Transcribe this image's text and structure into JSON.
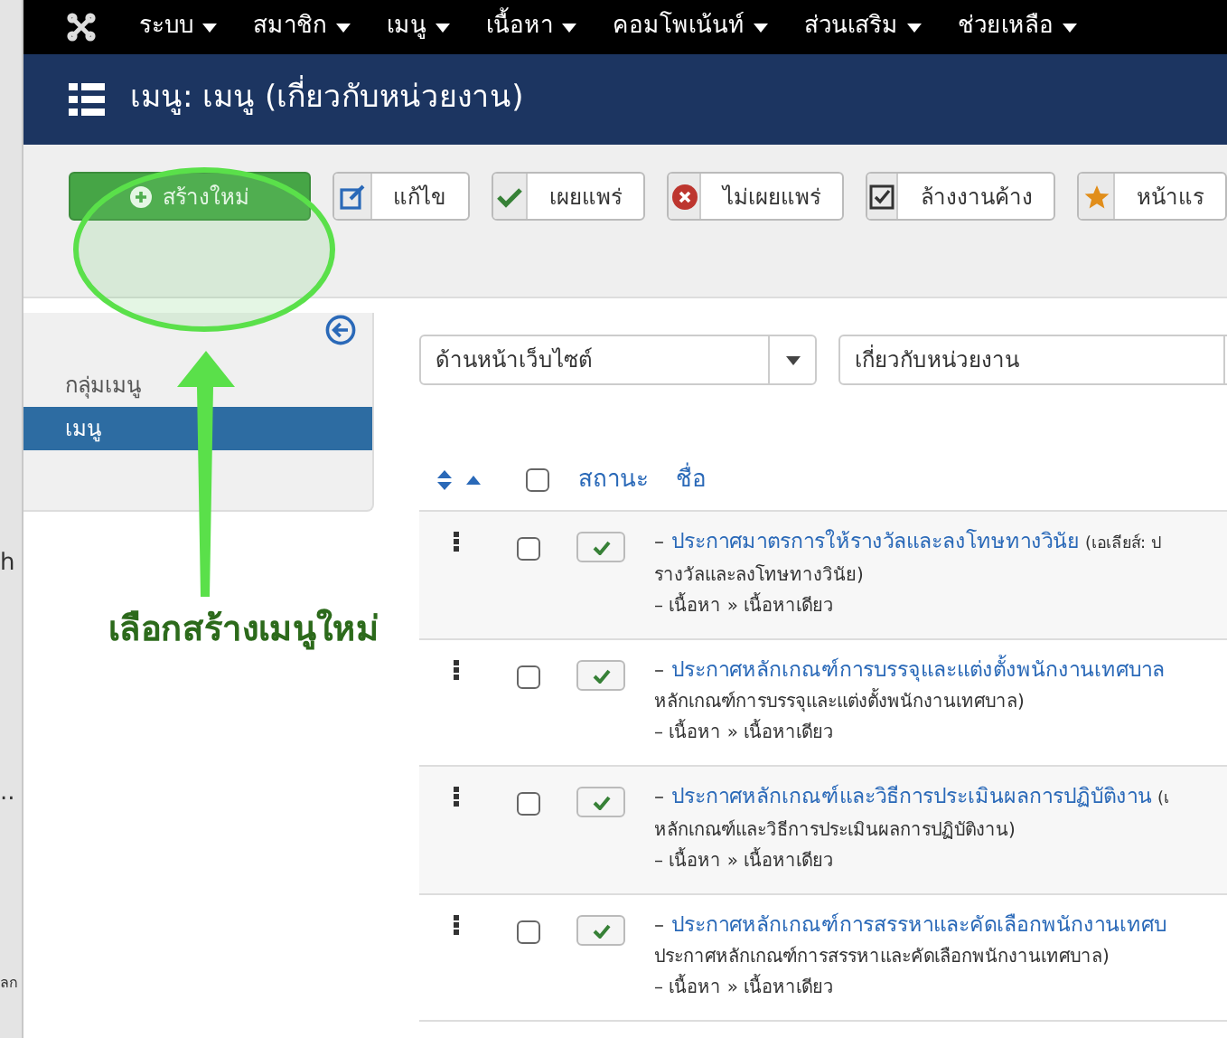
{
  "background_window": {
    "texts": [
      "h",
      "..",
      "ลก"
    ]
  },
  "menubar": {
    "items": [
      {
        "label": "ระบบ"
      },
      {
        "label": "สมาชิก"
      },
      {
        "label": "เมนู"
      },
      {
        "label": "เนื้อหา"
      },
      {
        "label": "คอมโพเน้นท์"
      },
      {
        "label": "ส่วนเสริม"
      },
      {
        "label": "ช่วยเหลือ"
      }
    ]
  },
  "header": {
    "title": "เมนู: เมนู (เกี่ยวกับหน่วยงาน)"
  },
  "toolbar": [
    {
      "kind": "new",
      "label": "สร้างใหม่"
    },
    {
      "kind": "edit",
      "label": "แก้ไข"
    },
    {
      "kind": "publish",
      "label": "เผยแพร่"
    },
    {
      "kind": "unpublish",
      "label": "ไม่เผยแพร่"
    },
    {
      "kind": "checkin",
      "label": "ล้างงานค้าง"
    },
    {
      "kind": "home",
      "label": "หน้าแร"
    }
  ],
  "sidebar": {
    "items": [
      {
        "label": "กลุ่มเมนู",
        "selected": false
      },
      {
        "label": "เมนู",
        "selected": true
      }
    ]
  },
  "filters": [
    {
      "value": "ด้านหน้าเว็บไซต์"
    },
    {
      "value": "เกี่ยวกับหน่วยงาน"
    }
  ],
  "table": {
    "select_all": {
      "checked": false
    },
    "columns": [
      "สถานะ",
      "ชื่อ"
    ],
    "rows": [
      {
        "dash": "–",
        "title": "ประกาศมาตรการให้รางวัลและลงโทษทางวินัย",
        "alias": "(เอเลียส์: ป",
        "alias_rest": "รางวัลและลงโทษทางวินัย)",
        "type": "– เนื้อหา » เนื้อหาเดียว",
        "published": true,
        "checked": false
      },
      {
        "dash": "–",
        "title": "ประกาศหลักเกณฑ์การบรรจุและแต่งตั้งพนักงานเทศบาล",
        "alias_rest": "หลักเกณฑ์การบรรจุและแต่งตั้งพนักงานเทศบาล)",
        "type": "– เนื้อหา » เนื้อหาเดียว",
        "published": true,
        "checked": false
      },
      {
        "dash": "–",
        "title": "ประกาศหลักเกณฑ์และวิธีการประเมินผลการปฏิบัติงาน",
        "alias": "(เ",
        "alias_rest": "หลักเกณฑ์และวิธีการประเมินผลการปฏิบัติงาน)",
        "type": "– เนื้อหา » เนื้อหาเดียว",
        "published": true,
        "checked": false
      },
      {
        "dash": "–",
        "title": "ประกาศหลักเกณฑ์การสรรหาและคัดเลือกพนักงานเทศบ",
        "alias_rest": "ประกาศหลักเกณฑ์การสรรหาและคัดเลือกพนักงานเทศบาล)",
        "type": "– เนื้อหา » เนื้อหาเดียว",
        "published": true,
        "checked": false
      }
    ]
  },
  "annotation": {
    "label": "เลือกสร้างเมนูใหม่"
  }
}
